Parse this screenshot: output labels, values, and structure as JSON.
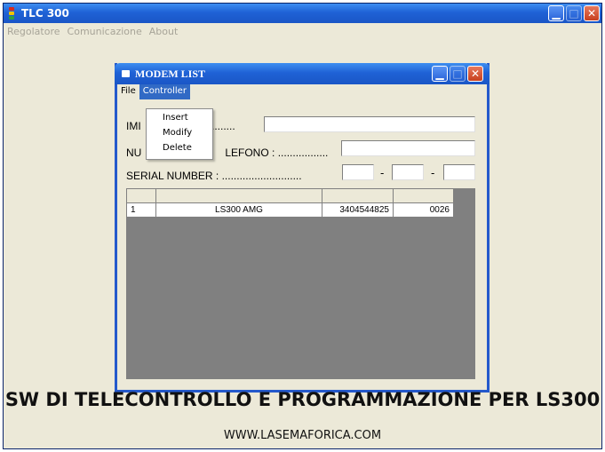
{
  "main_window": {
    "title": "TLC 300",
    "menu": [
      "Regolatore",
      "Comunicazione",
      "About"
    ]
  },
  "modem_window": {
    "title": "MODEM LIST",
    "menu": [
      "File",
      "Controller"
    ],
    "controller_menu": [
      "Insert",
      "Modify",
      "Delete"
    ],
    "fields": {
      "imei_label_start": "IMI",
      "imei_label_dots": "............",
      "phone_label_start": "NU",
      "phone_label_end": "LEFONO : .................",
      "serial_label": "SERIAL NUMBER : ...........................",
      "serial_sep_1": "-",
      "serial_sep_2": "-"
    },
    "table": {
      "rows": [
        {
          "index": "1",
          "name": "LS300 AMG",
          "phone": "3404544825",
          "serial": "0026"
        }
      ]
    }
  },
  "footer": {
    "headline": "SW DI TELECONTROLLO E PROGRAMMAZIONE PER LS300",
    "url": "WWW.LASEMAFORICA.COM"
  },
  "colors": {
    "titlebar_blue": "#1f62d6",
    "window_bg": "#ece9d8",
    "menu_highlight": "#316ac5",
    "grid_bg": "#808080"
  }
}
